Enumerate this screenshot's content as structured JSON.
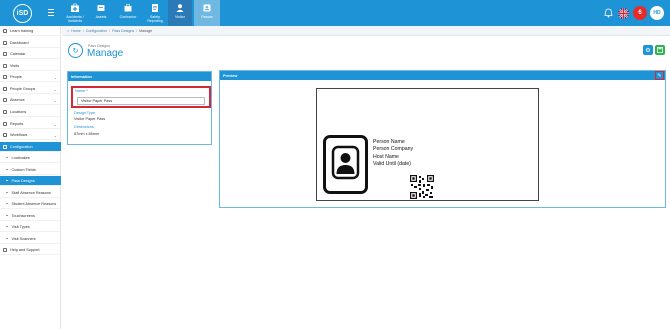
{
  "app": {
    "logo_text": "iSD"
  },
  "topnav": [
    {
      "label": "Accidents / Incidents",
      "icon": "first-aid-icon"
    },
    {
      "label": "Assets",
      "icon": "assets-icon"
    },
    {
      "label": "Contractor",
      "icon": "contractor-icon"
    },
    {
      "label": "Safety Reporting",
      "icon": "safety-icon"
    },
    {
      "label": "Visitor",
      "icon": "visitor-icon"
    },
    {
      "label": "Passes",
      "icon": "passes-icon"
    }
  ],
  "topright": {
    "badge": "6",
    "avatar": "HD"
  },
  "sidebar": [
    {
      "label": "Learn training",
      "type": "item"
    },
    {
      "label": "Dashboard",
      "type": "item"
    },
    {
      "label": "Calendar",
      "type": "item"
    },
    {
      "label": "Visits",
      "type": "item"
    },
    {
      "label": "People",
      "type": "group"
    },
    {
      "label": "People Groups",
      "type": "group"
    },
    {
      "label": "Absence",
      "type": "group"
    },
    {
      "label": "Locations",
      "type": "item"
    },
    {
      "label": "Reports",
      "type": "group"
    },
    {
      "label": "Workflows",
      "type": "group"
    },
    {
      "label": "Configuration",
      "type": "active"
    },
    {
      "label": "Lockbakes",
      "type": "sub"
    },
    {
      "label": "Custom Fields",
      "type": "sub"
    },
    {
      "label": "Pass Designs",
      "type": "subactive"
    },
    {
      "label": "Staff Absence Reasons",
      "type": "sub"
    },
    {
      "label": "Student Absence Reasons",
      "type": "sub"
    },
    {
      "label": "Touchscreens",
      "type": "sub"
    },
    {
      "label": "Visit Types",
      "type": "sub"
    },
    {
      "label": "Visit Scanners",
      "type": "sub"
    },
    {
      "label": "Help and Support",
      "type": "item"
    }
  ],
  "breadcrumb": [
    "Home",
    "Configuration",
    "Pass Designs",
    "Manage"
  ],
  "page": {
    "subtitle": "Pass Designs",
    "title": "Manage"
  },
  "info_panel": {
    "header": "Information",
    "name_label": "Name",
    "name_required": "*",
    "name_value": "Visitor Paper Pass",
    "design_type_label": "Design Type",
    "design_type_value": "Visitor Paper Pass",
    "dimensions_label": "Dimensions",
    "dimensions_value": "87mm x 86mm"
  },
  "preview_panel": {
    "header": "Preview",
    "pass_lines": [
      "Person Name",
      "Person Company",
      "Host Name",
      "Valid Until (date)"
    ]
  },
  "colors": {
    "primary": "#1e93d6",
    "highlight": "#d3283a",
    "green": "#2fb34a"
  }
}
